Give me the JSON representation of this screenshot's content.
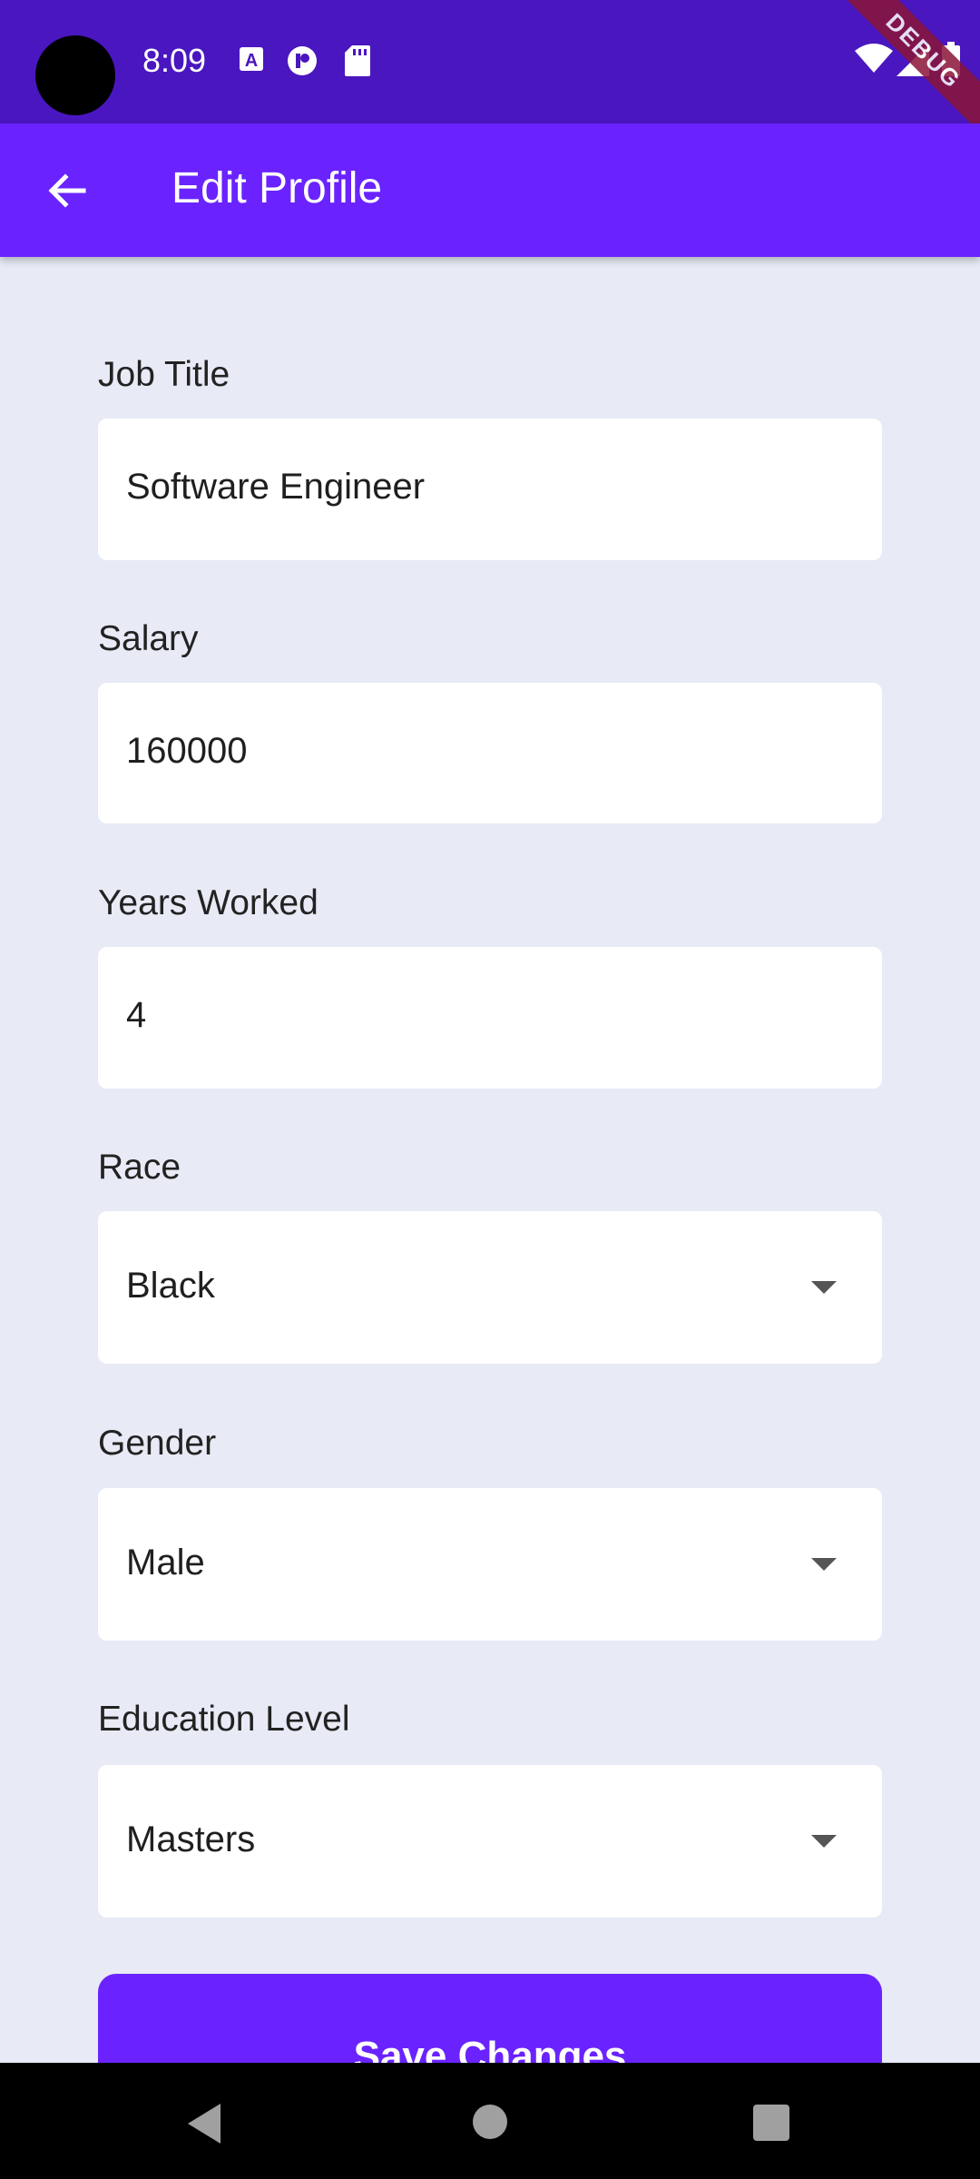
{
  "status_bar": {
    "time": "8:09",
    "debug_label": "DEBUG",
    "icons": [
      "a-icon",
      "record-icon",
      "sd-card-icon",
      "wifi-icon",
      "signal-icon",
      "battery-icon"
    ]
  },
  "app_bar": {
    "title": "Edit Profile",
    "back_icon": "arrow-back-icon"
  },
  "form": {
    "job_title": {
      "label": "Job Title",
      "value": "Software Engineer"
    },
    "salary": {
      "label": "Salary",
      "value": "160000"
    },
    "years_worked": {
      "label": "Years Worked",
      "value": "4"
    },
    "race": {
      "label": "Race",
      "value": "Black"
    },
    "gender": {
      "label": "Gender",
      "value": "Male"
    },
    "education_level": {
      "label": "Education Level",
      "value": "Masters"
    }
  },
  "save_button": {
    "label": "Save Changes"
  },
  "colors": {
    "status_bar": "#4a16bf",
    "app_bar": "#6a23ff",
    "background": "#e8eaf6",
    "field": "#ffffff"
  }
}
